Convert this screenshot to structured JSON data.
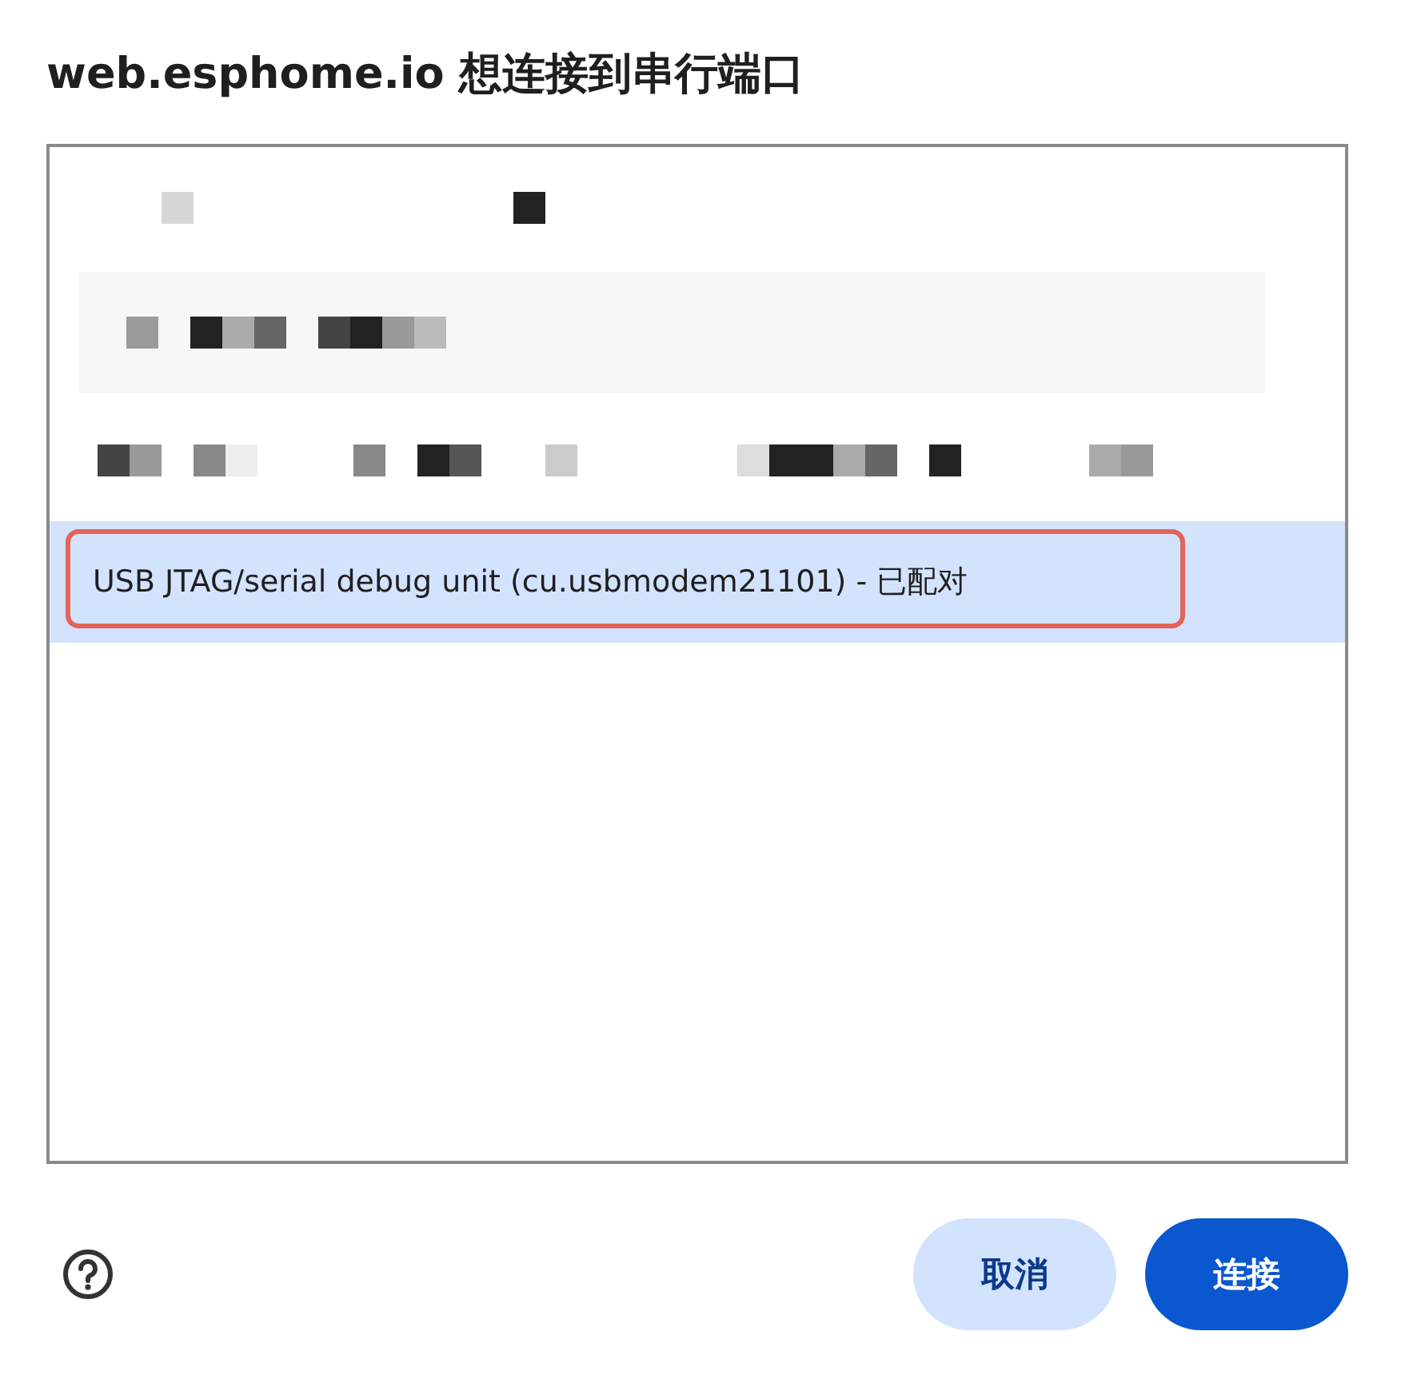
{
  "dialog": {
    "title": "web.esphome.io 想连接到串行端口"
  },
  "ports": [
    {
      "kind": "redacted",
      "selected": false,
      "hovered": false
    },
    {
      "kind": "redacted",
      "selected": false,
      "hovered": true
    },
    {
      "kind": "redacted",
      "selected": false,
      "hovered": false
    },
    {
      "kind": "text",
      "label": "USB JTAG/serial debug unit (cu.usbmodem21101) - 已配对",
      "selected": true,
      "hovered": false,
      "highlighted": true
    }
  ],
  "buttons": [
    {
      "kind": "secondary",
      "label": "取消"
    },
    {
      "kind": "primary",
      "label": "连接"
    }
  ]
}
